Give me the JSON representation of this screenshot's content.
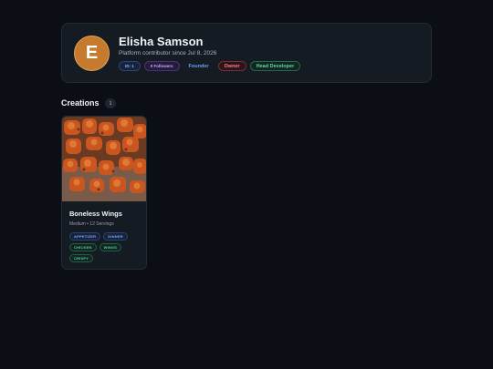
{
  "profile": {
    "avatar_letter": "E",
    "name": "Elisha Samson",
    "subtitle": "Platform contributor since Jul 8, 2026",
    "badges": {
      "id": "ID: 1",
      "followers": "0 Followers",
      "founder": "Founder",
      "owner": "Owner",
      "head_developer": "Head Developer"
    }
  },
  "creations": {
    "title": "Creations",
    "count": "1",
    "recipes": [
      {
        "title": "Boneless Wings",
        "meta": "Medium • 12 Servings",
        "tags": [
          "APPETIZER",
          "DINNER",
          "CHICKEN",
          "WINGS",
          "CRISPY"
        ]
      }
    ]
  },
  "colors": {
    "background": "#0b0e14",
    "card": "#151b23",
    "avatar": "#c57a2e",
    "tag_blue": "#7ea6f5",
    "tag_green": "#5cc99a",
    "owner": "#ff7e86"
  }
}
